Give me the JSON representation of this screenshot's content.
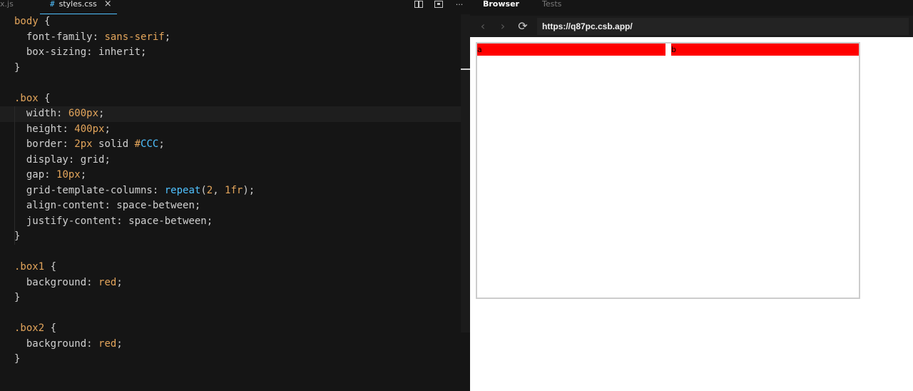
{
  "editor": {
    "prev_tab_label": "x.js",
    "active_tab": {
      "hash": "#",
      "label": "styles.css",
      "close": "×"
    },
    "actions": {
      "split": "split-editor-icon",
      "preview": "open-preview-icon",
      "more": "···"
    },
    "code_lines": [
      "body {",
      "  font-family: sans-serif;",
      "  box-sizing: inherit;",
      "}",
      "",
      ".box {",
      "  width: 600px;",
      "  height: 400px;",
      "  border: 2px solid #CCC;",
      "  display: grid;",
      "  gap: 10px;",
      "  grid-template-columns: repeat(2, 1fr);",
      "  align-content: space-between;",
      "  justify-content: space-between;",
      "}",
      "",
      ".box1 {",
      "  background: red;",
      "}",
      "",
      ".box2 {",
      "  background: red;",
      "}"
    ]
  },
  "browser": {
    "tabs": [
      "Browser",
      "Tests"
    ],
    "active_tab": "Browser",
    "url": "https://q87pc.csb.app/",
    "nav": {
      "back": "‹",
      "forward": "›",
      "reload": "⟳"
    },
    "demo": {
      "box1_text": "a",
      "box2_text": "b",
      "box_color": "#ff0000",
      "border_color": "#cccccc"
    }
  }
}
